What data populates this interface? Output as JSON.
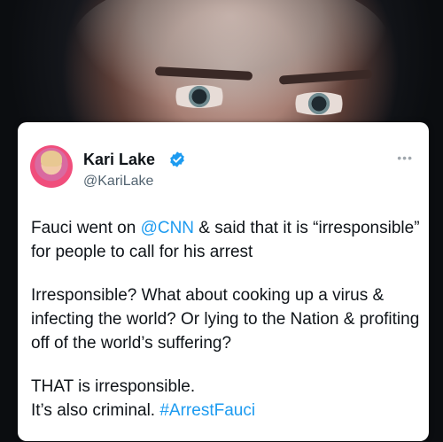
{
  "tweet": {
    "author_name": "Kari Lake",
    "author_handle": "@KariLake",
    "more_icon": "more-horizontal-icon",
    "verified_icon": "verified-badge-icon",
    "colors": {
      "accent": "#1d9bf0",
      "text": "#0f1419",
      "muted": "#536471"
    },
    "paragraphs": [
      {
        "pre": "Fauci went on ",
        "mention": "@CNN",
        "post": " & said that it is “irresponsible” for people to call for his arrest"
      },
      {
        "text": "Irresponsible? What about cooking up a virus & infecting the world? Or lying to the Nation & profiting off of the world’s suffering?"
      },
      {
        "line1": "THAT is irresponsible.",
        "line2_pre": "It’s also criminal. ",
        "hashtag": "#ArrestFauci"
      }
    ]
  }
}
